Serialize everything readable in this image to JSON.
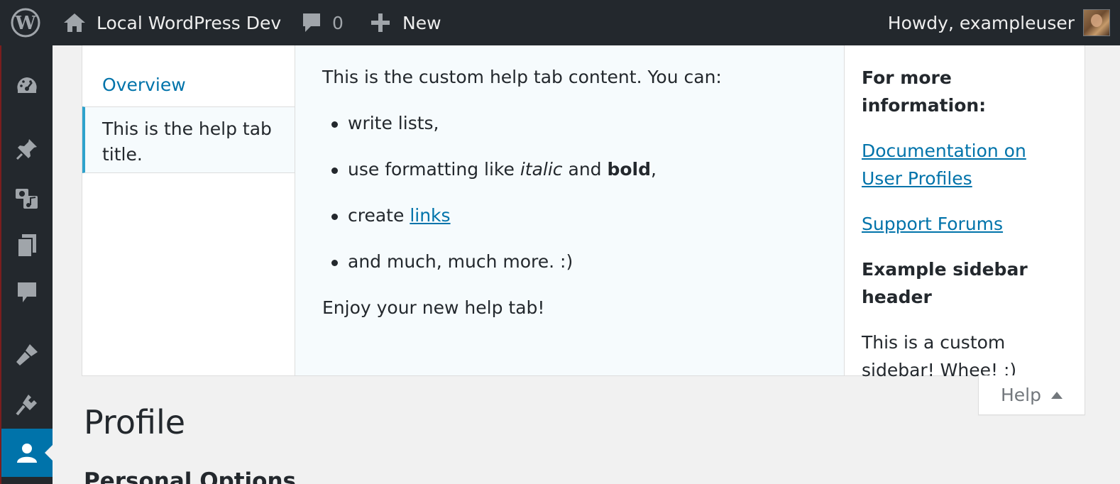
{
  "admin_bar": {
    "site_name": "Local WordPress Dev",
    "comments_count": "0",
    "new_label": "New",
    "howdy": "Howdy, exampleuser",
    "bg_color": "#23282d"
  },
  "admin_menu": {
    "items": [
      {
        "icon": "dashboard-icon"
      },
      {
        "icon": "pin-icon"
      },
      {
        "icon": "media-icon"
      },
      {
        "icon": "pages-icon"
      },
      {
        "icon": "comments-icon"
      },
      {
        "icon": "appearance-icon"
      },
      {
        "icon": "plugins-icon"
      },
      {
        "icon": "users-icon",
        "current": true
      }
    ],
    "current_color": "#0073aa"
  },
  "help": {
    "tabs": [
      {
        "label": "Overview"
      },
      {
        "label": "This is the help tab title.",
        "active": true
      }
    ],
    "content": {
      "intro": "This is the custom help tab content. You can:",
      "list": [
        {
          "text": "write lists,"
        },
        {
          "prefix": "use formatting like ",
          "italic": "italic",
          "middle": " and ",
          "bold": "bold",
          "suffix": ","
        },
        {
          "prefix": "create ",
          "link": "links"
        },
        {
          "text": "and much, much more. :)"
        }
      ],
      "outro": "Enjoy your new help tab!"
    },
    "sidebar": {
      "heading": "For more information:",
      "links": [
        "Documentation on User Profiles",
        "Support Forums"
      ],
      "example_header": "Example sidebar header",
      "example_text": "This is a custom sidebar! Whee! :)"
    },
    "toggle_label": "Help"
  },
  "page": {
    "title": "Profile",
    "section_heading": "Personal Options"
  },
  "colors": {
    "link": "#0073aa",
    "active_tab_border": "#2ea2cc",
    "help_content_bg": "#f6fbfd"
  }
}
